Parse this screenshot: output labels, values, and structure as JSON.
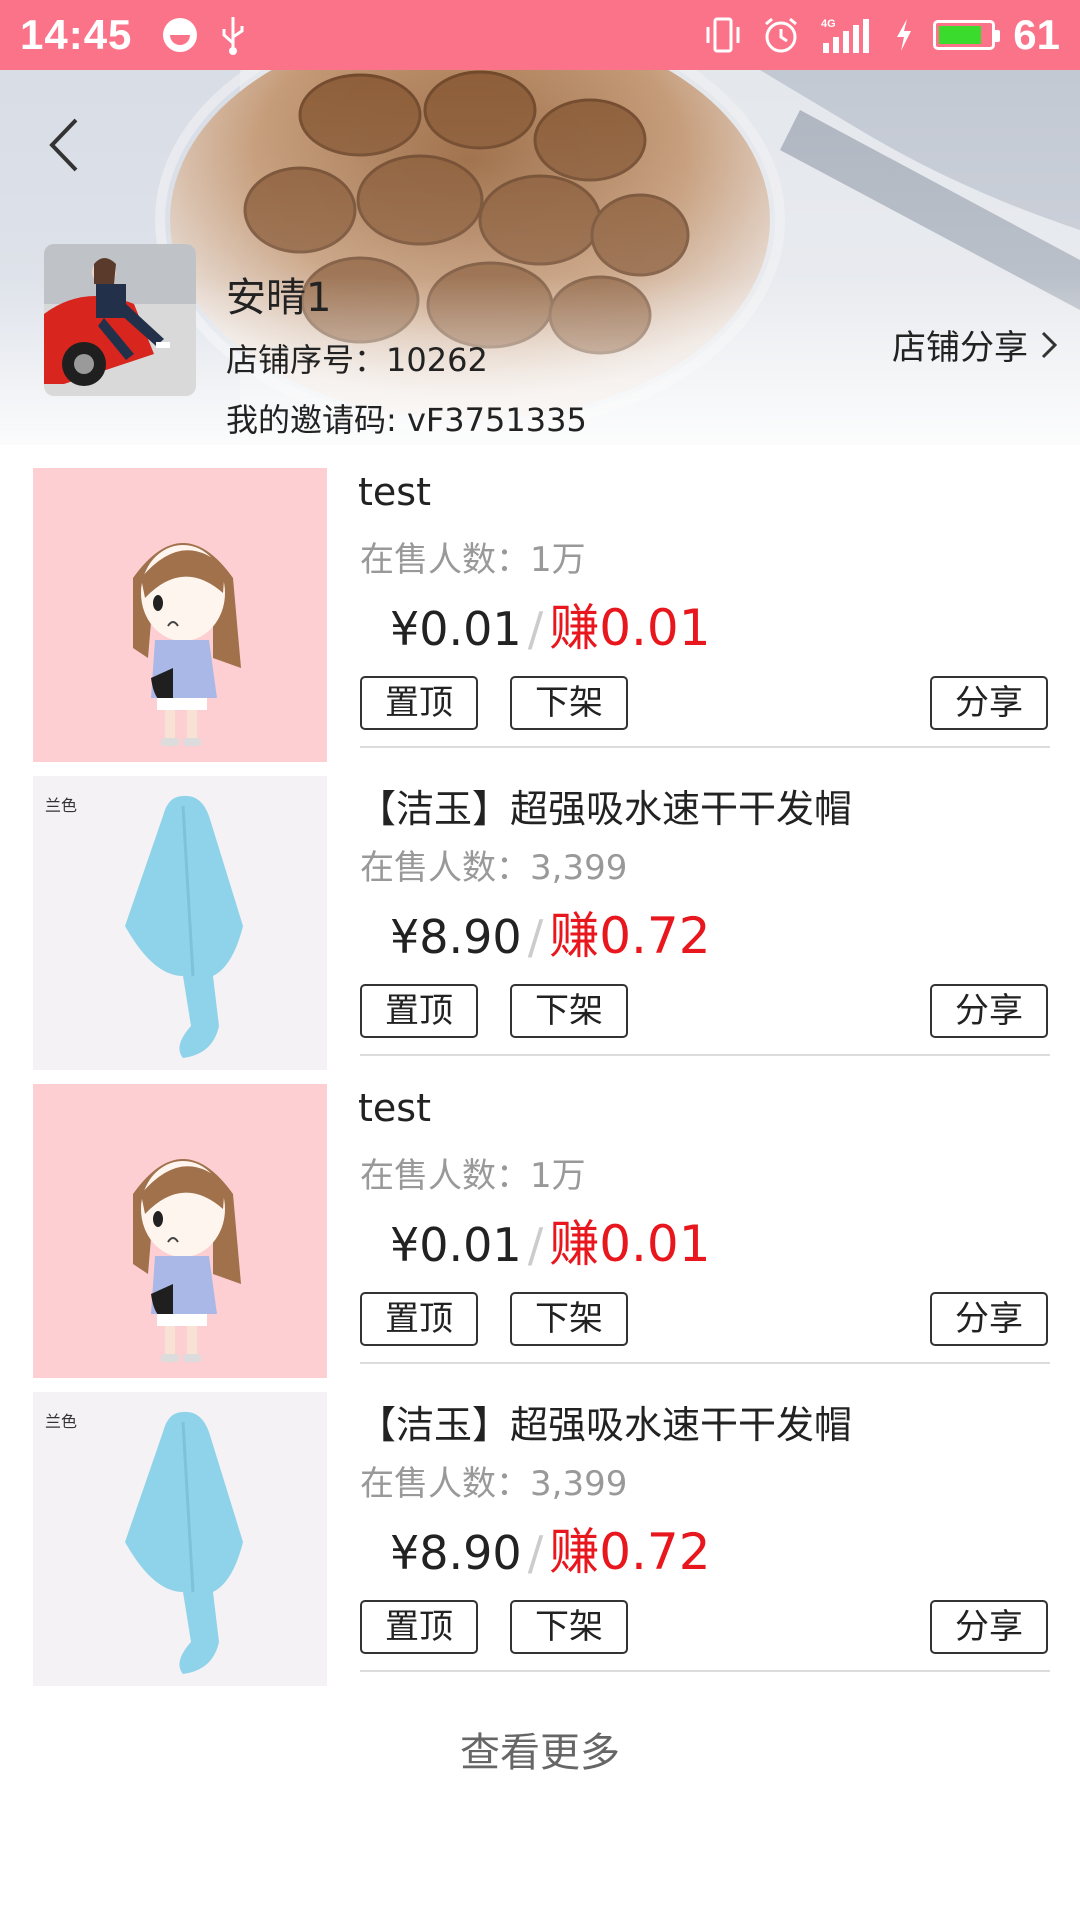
{
  "status_bar": {
    "time": "14:45",
    "battery_level": "61",
    "icons": [
      "smiley-icon",
      "usb-icon",
      "vibrate-icon",
      "alarm-icon",
      "4g-signal-icon",
      "charging-icon",
      "battery-icon"
    ],
    "background_color": "#fb7389",
    "battery_fill_color": "#3adb2c"
  },
  "header": {
    "shop_name": "安晴1",
    "shop_number": "店铺序号：10262",
    "invite_code": "我的邀请码:  vF3751335",
    "share_label": "店铺分享"
  },
  "products": [
    {
      "title": "test",
      "sales": "在售人数：1万",
      "price": "¥0.01",
      "earn": "赚0.01",
      "thumb_type": "cartoon-girl",
      "thumb_tag": "",
      "buttons": {
        "pin": "置顶",
        "unlist": "下架",
        "share": "分享"
      }
    },
    {
      "title": "【洁玉】超强吸水速干干发帽",
      "sales": "在售人数：3,399",
      "price": "¥8.90",
      "earn": "赚0.72",
      "thumb_type": "towel-cap",
      "thumb_tag": "兰色",
      "buttons": {
        "pin": "置顶",
        "unlist": "下架",
        "share": "分享"
      }
    },
    {
      "title": "test",
      "sales": "在售人数：1万",
      "price": "¥0.01",
      "earn": "赚0.01",
      "thumb_type": "cartoon-girl",
      "thumb_tag": "",
      "buttons": {
        "pin": "置顶",
        "unlist": "下架",
        "share": "分享"
      }
    },
    {
      "title": "【洁玉】超强吸水速干干发帽",
      "sales": "在售人数：3,399",
      "price": "¥8.90",
      "earn": "赚0.72",
      "thumb_type": "towel-cap",
      "thumb_tag": "兰色",
      "buttons": {
        "pin": "置顶",
        "unlist": "下架",
        "share": "分享"
      }
    }
  ],
  "more_label": "查看更多",
  "colors": {
    "earn": "#e8161d",
    "pink_thumb": "#fdcfd3",
    "towel": "#8fd3ea"
  }
}
